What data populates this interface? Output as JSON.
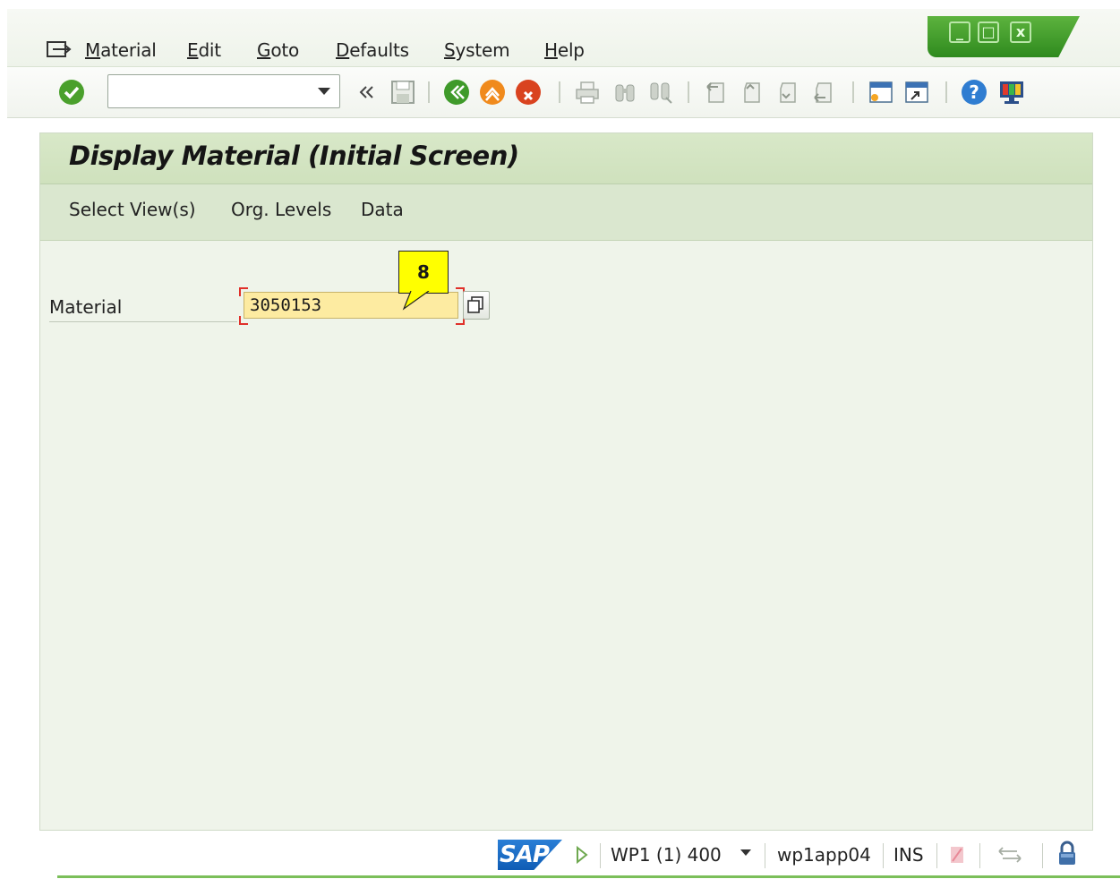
{
  "menubar": {
    "items": [
      "Material",
      "Edit",
      "Goto",
      "Defaults",
      "System",
      "Help"
    ]
  },
  "window_controls": {
    "minimize": "_",
    "maximize": "□",
    "close": "x"
  },
  "toolbar": {
    "command_field_value": "",
    "icons": [
      "enter-icon",
      "back-icon",
      "save-icon",
      "back-green-icon",
      "exit-icon",
      "cancel-icon",
      "print-icon",
      "find-icon",
      "find-next-icon",
      "first-page-icon",
      "previous-page-icon",
      "next-page-icon",
      "last-page-icon",
      "new-session-icon",
      "create-shortcut-icon",
      "help-icon",
      "customize-layout-icon"
    ]
  },
  "screen": {
    "title": "Display Material (Initial Screen)",
    "app_buttons": [
      "Select View(s)",
      "Org. Levels",
      "Data"
    ]
  },
  "form": {
    "material_label": "Material",
    "material_value": "3050153"
  },
  "callout": {
    "number": "8"
  },
  "statusbar": {
    "logo": "SAP",
    "system": "WP1 (1) 400",
    "server": "wp1app04",
    "mode": "INS"
  },
  "colors": {
    "panel_bg": "#eff4ea",
    "title_bg": "#d8e8c8",
    "input_bg": "#fdeba1",
    "callout_bg": "#ffff00",
    "window_green": "#2f8a1e",
    "sap_blue": "#0f5cb5"
  }
}
